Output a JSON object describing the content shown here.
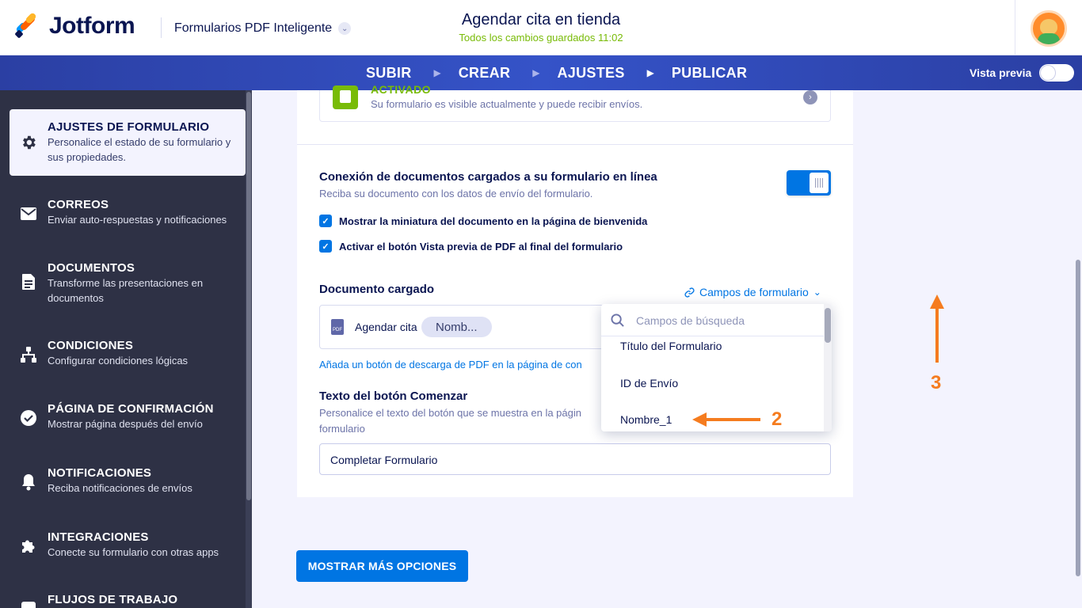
{
  "header": {
    "logo_text": "Jotform",
    "product": "Formularios PDF Inteligente",
    "form_title": "Agendar cita en tienda",
    "saved_status": "Todos los cambios guardados 11:02"
  },
  "nav": {
    "items": [
      {
        "label": "SUBIR"
      },
      {
        "label": "CREAR"
      },
      {
        "label": "AJUSTES"
      },
      {
        "label": "PUBLICAR"
      }
    ],
    "active": "AJUSTES",
    "preview_label": "Vista previa"
  },
  "sidebar": {
    "items": [
      {
        "title": "AJUSTES DE FORMULARIO",
        "desc": "Personalice el estado de su formulario y sus propiedades.",
        "icon": "gear-icon"
      },
      {
        "title": "CORREOS",
        "desc": "Enviar auto-respuestas y notificaciones",
        "icon": "mail-icon"
      },
      {
        "title": "DOCUMENTOS",
        "desc": "Transforme las presentaciones en documentos",
        "icon": "document-icon"
      },
      {
        "title": "CONDICIONES",
        "desc": "Configurar condiciones lógicas",
        "icon": "sitemap-icon"
      },
      {
        "title": "PÁGINA DE CONFIRMACIÓN",
        "desc": "Mostrar página después del envío",
        "icon": "check-circle-icon"
      },
      {
        "title": "NOTIFICACIONES",
        "desc": "Reciba notificaciones de envíos",
        "icon": "bell-icon"
      },
      {
        "title": "INTEGRACIONES",
        "desc": "Conecte su formulario con otras apps",
        "icon": "puzzle-icon"
      },
      {
        "title": "FLUJOS DE TRABAJO",
        "desc": "",
        "icon": "workflow-icon"
      }
    ]
  },
  "status": {
    "label": "ACTIVADO",
    "desc": "Su formulario es visible actualmente y puede recibir envíos."
  },
  "connection": {
    "title": "Conexión de documentos cargados a su formulario en línea",
    "desc": "Reciba su documento con los datos de envío del formulario.",
    "check1": "Mostrar la miniatura del documento en la página de bienvenida",
    "check2": "Activar el botón Vista previa de PDF al final del formulario"
  },
  "document": {
    "title": "Documento cargado",
    "fields_link": "Campos de formulario",
    "doc_name": "Agendar cita",
    "chip": "Nomb...",
    "download_link": "Añada un botón de descarga de PDF en la página de con"
  },
  "start_button": {
    "title": "Texto del botón Comenzar",
    "desc_line1": "Personalice el texto del botón que se muestra en la págin",
    "desc_line2": "formulario",
    "value": "Completar Formulario"
  },
  "more_options": "MOSTRAR MÁS OPCIONES",
  "dropdown": {
    "placeholder": "Campos de búsqueda",
    "items": [
      "Título del Formulario",
      "ID de Envío",
      "Nombre_1"
    ]
  },
  "annotations": {
    "step2": "2",
    "step3": "3",
    "color": "#f57c1f"
  },
  "colors": {
    "accent": "#0075e3",
    "sidebar": "#2e3145",
    "nav": "#3553c8",
    "success": "#78bb07"
  }
}
